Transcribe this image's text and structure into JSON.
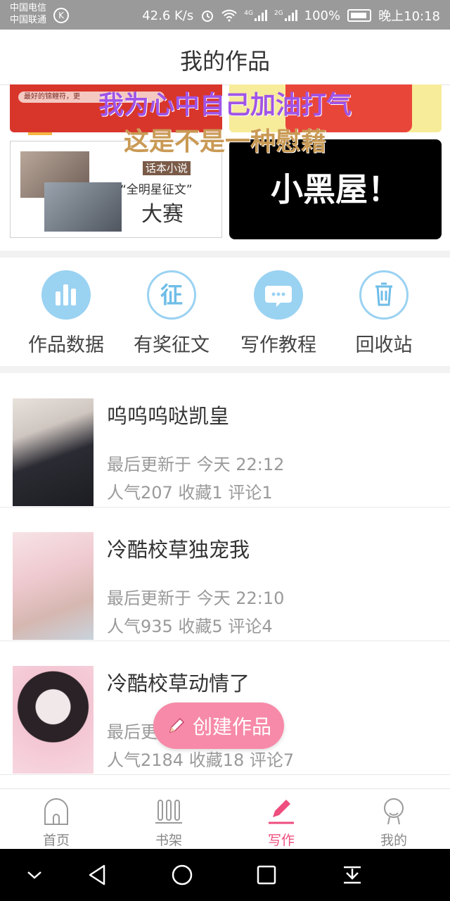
{
  "status_bar": {
    "carrier_1": "中国电信",
    "carrier_2": "中国联通",
    "k_badge": "K",
    "speed": "42.6 K/s",
    "net_4g": "4G",
    "net_2g": "2G",
    "battery": "100%",
    "time": "晚上10:18"
  },
  "header": {
    "title": "我的作品"
  },
  "banners": {
    "red_banner_text": "最好的锦鲤符，更",
    "overlay_line1": "我为心中自己加油打气",
    "overlay_line2": "这是不是一种慰藉",
    "contest_tag": "话本小说",
    "contest_subtitle": "“全明星征文”",
    "contest_title": "大赛",
    "black_banner_text": "小黑屋！"
  },
  "quick_actions": [
    {
      "label": "作品数据",
      "icon": "bar-chart-icon"
    },
    {
      "label": "有奖征文",
      "icon": "contest-icon",
      "glyph": "征"
    },
    {
      "label": "写作教程",
      "icon": "chat-bubble-icon"
    },
    {
      "label": "回收站",
      "icon": "trash-icon"
    }
  ],
  "works": [
    {
      "title": "呜呜呜哒凯皇",
      "updated": "最后更新于 今天 22:12",
      "stats": "人气207 收藏1 评论1"
    },
    {
      "title": "冷酷校草独宠我",
      "updated": "最后更新于 今天 22:10",
      "stats": "人气935 收藏5 评论4"
    },
    {
      "title": "冷酷校草动情了",
      "updated": "最后更新于 今天 22:07",
      "stats": "人气2184 收藏18 评论7"
    }
  ],
  "fab": {
    "label": "创建作品"
  },
  "tab_bar": [
    {
      "label": "首页",
      "icon": "home-icon"
    },
    {
      "label": "书架",
      "icon": "bookshelf-icon"
    },
    {
      "label": "写作",
      "icon": "pencil-icon"
    },
    {
      "label": "我的",
      "icon": "profile-icon"
    }
  ],
  "colors": {
    "accent": "#ee4d7e",
    "icon_blue": "#9ad2f2",
    "fab": "#f78aa8"
  }
}
